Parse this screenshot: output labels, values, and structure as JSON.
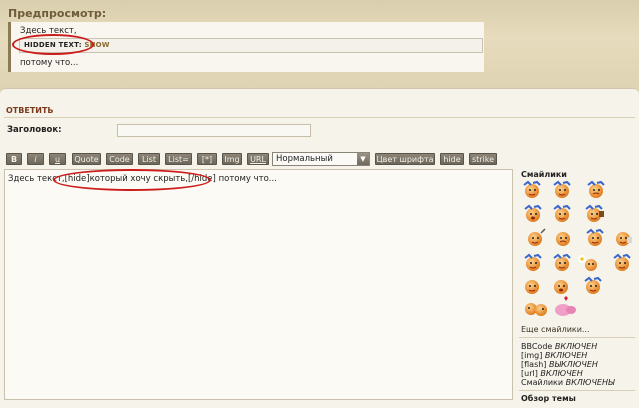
{
  "preview": {
    "title": "Предпросмотр:",
    "line1": "Здесь текст,",
    "hidden_text_label": "HIDDEN TEXT:",
    "hidden_text_show": "SHOW",
    "line3": "потому что..."
  },
  "reply": {
    "title": "ОТВЕТИТЬ",
    "subject_label": "Заголовок:",
    "subject_value": ""
  },
  "toolbar": {
    "buttons": [
      "B",
      "i",
      "u",
      "Quote",
      "Code",
      "List",
      "List=",
      "[*]",
      "Img",
      "URL"
    ],
    "font_size_selected": "Нормальный",
    "font_color_label": "Цвет шрифта",
    "hide_label": "hide",
    "strike_label": "strike"
  },
  "editor": {
    "text_before": "Здесь текст,",
    "text_tag": "[hide]который хочу скрыть,[/hide]",
    "text_after": "потому что..."
  },
  "sidebar": {
    "smileys_title": "Смайлики",
    "more_smileys": "Еще смайлики...",
    "status": [
      {
        "label": "BBCode",
        "value": "ВКЛЮЧЕН"
      },
      {
        "label": "[img]",
        "value": "ВКЛЮЧЕН"
      },
      {
        "label": "[flash]",
        "value": "ВЫКЛЮЧЕН"
      },
      {
        "label": "[url]",
        "value": "ВКЛЮЧЕН"
      },
      {
        "label": "Смайлики",
        "value": "ВКЛЮЧЕНЫ"
      }
    ],
    "topic_review": "Обзор темы"
  },
  "colors": {
    "annotation_red": "#cc1b1b",
    "reply_title": "#7a3b1d",
    "button_bg": "#7a7468"
  }
}
